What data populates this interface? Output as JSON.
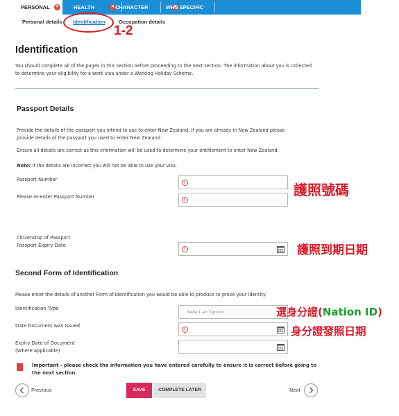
{
  "tabs": [
    {
      "label": "PERSONAL",
      "active": true
    },
    {
      "label": "HEALTH",
      "active": false
    },
    {
      "label": "CHARACTER",
      "active": false
    },
    {
      "label": "WHS SPECIFIC",
      "active": false
    }
  ],
  "subnav": {
    "personal_details": "Personal details",
    "identification": "Identification",
    "occupation_details": "Occupation details"
  },
  "annotations": {
    "step": "1-2",
    "passport_number": "護照號碼",
    "passport_expiry": "護照到期日期",
    "id_type_prefix": "選身分證(",
    "id_type_highlight": "Nation ID",
    "id_type_suffix": ")",
    "date_issued": "身分證發照日期"
  },
  "page": {
    "title": "Identification",
    "intro": "You should complete all of the pages in this section before proceeding to the next section. The information about you is collected to determine your eligibility for a work visa under a Working Holiday Scheme."
  },
  "passport": {
    "heading": "Passport Details",
    "desc1": "Provide the details of the passport you intend to use to enter New Zealand. If you are already in New Zealand please provide details of the passport you used to enter New Zealand.",
    "desc2": "Ensure all details are correct as this information will be used to determine your entitlement to enter New Zealand.",
    "note_label": "Note:",
    "note_text": " If the details are incorrect you will not be able to use your visa.",
    "number_label": "Passport Number",
    "reenter_label": "Please re-enter Passport Number",
    "citizenship_label": "Citizenship of Passport",
    "expiry_label": "Passport Expiry Date"
  },
  "second_id": {
    "heading": "Second Form of Identification",
    "desc": "Please enter the details of another Form of Identification you would be able to produce to prove your identity.",
    "type_label": "Identification Type",
    "type_placeholder": "Select an Option",
    "issued_label": "Date Document was Issued",
    "expiry_label_line1": "Expiry Date of Document",
    "expiry_label_line2": "(Where applicable)"
  },
  "footer": {
    "important": "Important - please check the information you have entered carefully to ensure it is correct before going to the next section.",
    "save": "SAVE",
    "complete_later": "COMPLETE LATER",
    "previous": "Previous",
    "next": "Next"
  },
  "colors": {
    "tab_blue": "#1a8fd6",
    "save_pink": "#d62a5e",
    "annotation_red": "#d81c2a",
    "annotation_green": "#1e9c2e"
  }
}
